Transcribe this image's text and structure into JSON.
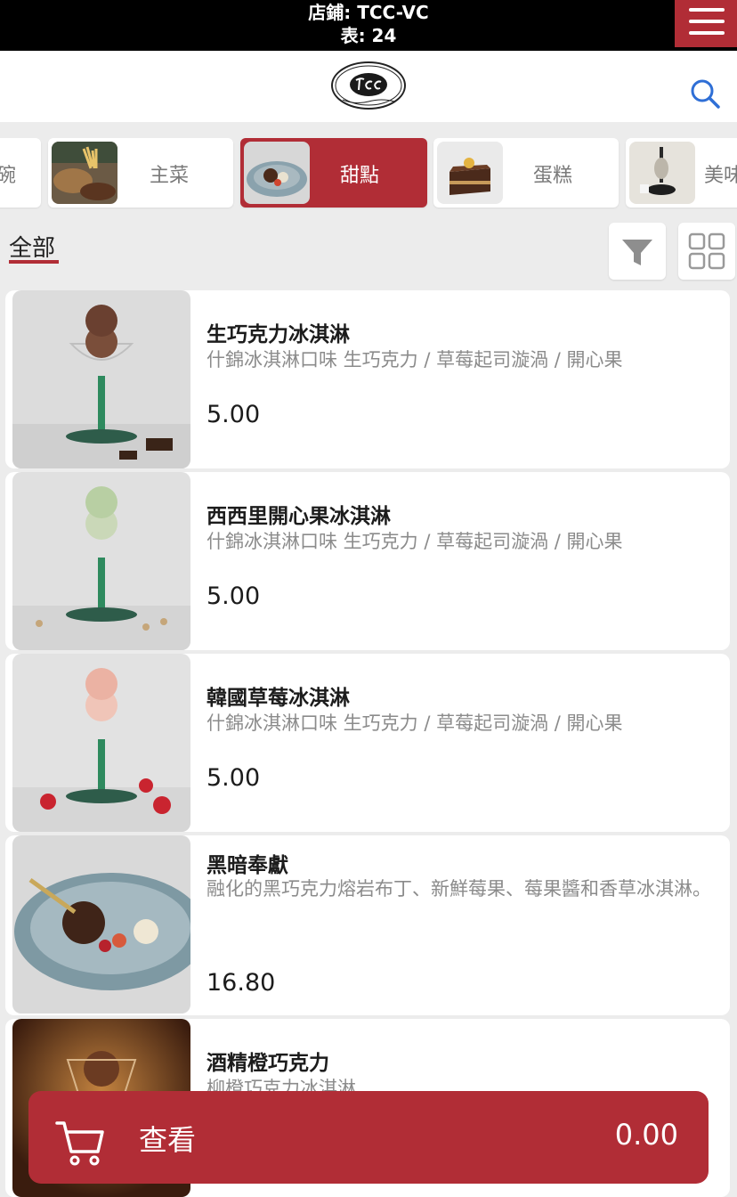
{
  "store_bar": {
    "store_line": "店鋪: TCC-VC",
    "table_line": "表: 24"
  },
  "icons": {
    "menu": "hamburger-menu-icon",
    "logo": "tcc-logo",
    "search": "search-icon",
    "filter": "filter-icon",
    "grid": "grid-view-icon",
    "cart": "cart-icon"
  },
  "categories": [
    {
      "label": "碗"
    },
    {
      "label": "主菜"
    },
    {
      "label": "甜點",
      "active": true
    },
    {
      "label": "蛋糕"
    },
    {
      "label": "美味"
    }
  ],
  "filter": {
    "tab_all": "全部"
  },
  "menu_items": [
    {
      "name": "生巧克力冰淇淋",
      "description": "什錦冰淇淋口味 生巧克力 / 草莓起司漩渦 / 開心果",
      "price": "5.00"
    },
    {
      "name": "西西里開心果冰淇淋",
      "description": "什錦冰淇淋口味 生巧克力 / 草莓起司漩渦 / 開心果",
      "price": "5.00"
    },
    {
      "name": "韓國草莓冰淇淋",
      "description": "什錦冰淇淋口味 生巧克力 / 草莓起司漩渦 / 開心果",
      "price": "5.00"
    },
    {
      "name": "黑暗奉獻",
      "description": "融化的黑巧克力熔岩布丁、新鮮莓果、莓果醬和香草冰淇淋。",
      "price": "16.80"
    },
    {
      "name": "酒精橙巧克力",
      "description": "柳橙巧克力冰淇淋",
      "price": ""
    }
  ],
  "cart": {
    "label": "查看",
    "total": "0.00"
  },
  "colors": {
    "accent": "#b12d36",
    "top_bar": "#000000",
    "search_blue": "#2f6fd6"
  }
}
